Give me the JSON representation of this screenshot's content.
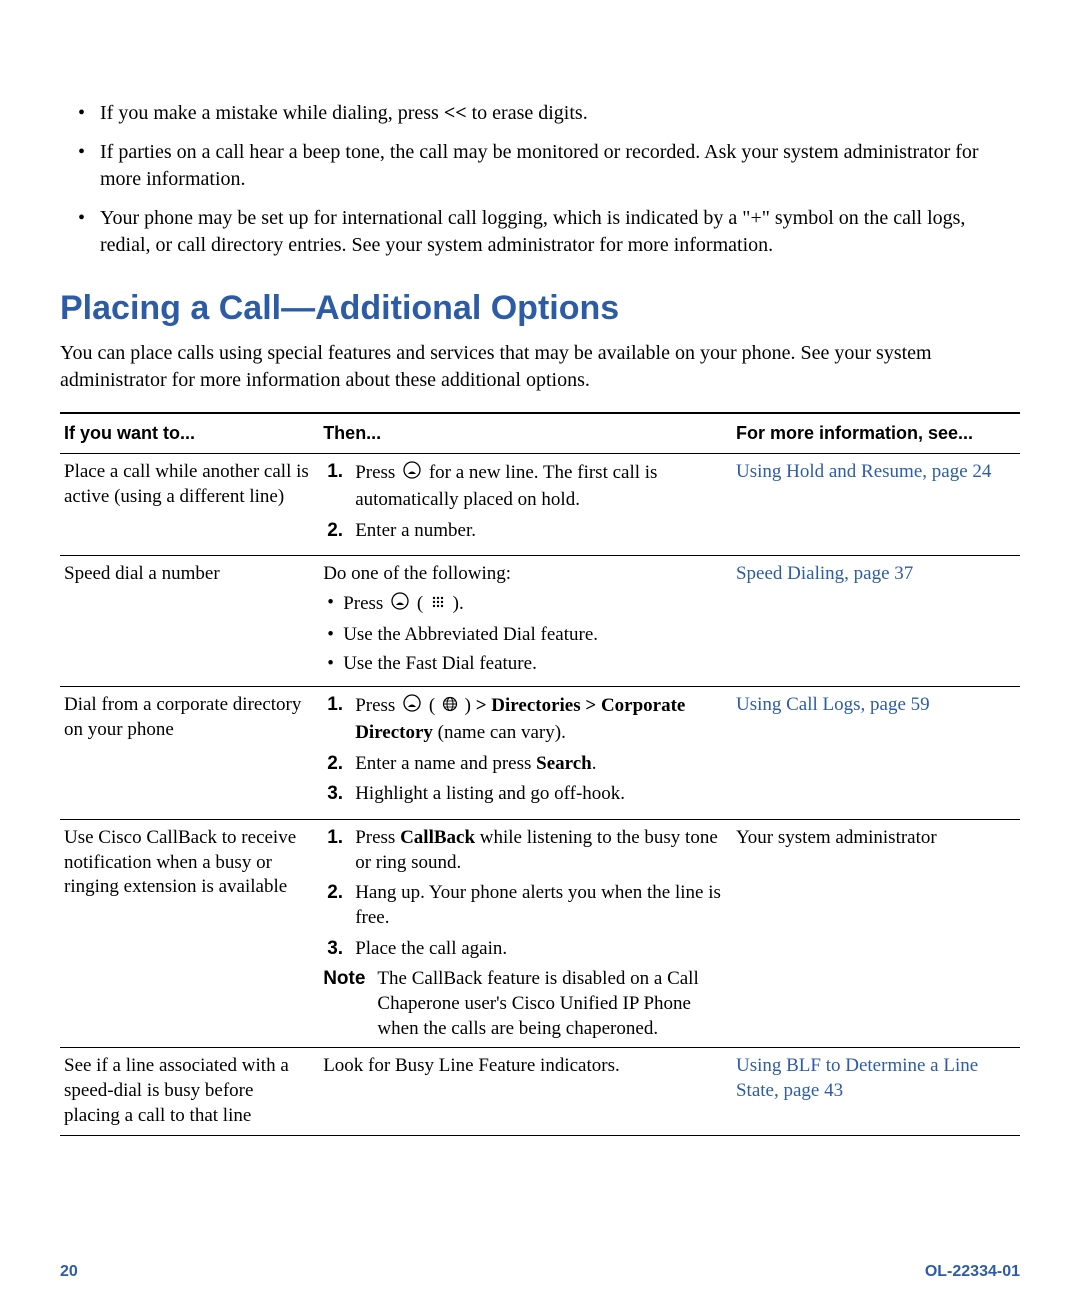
{
  "intro_bullets": {
    "b1_pre": "If you make a mistake while dialing, press ",
    "b1_key": "<<",
    "b1_post": " to erase digits.",
    "b2": "If parties on a call hear a beep tone, the call may be monitored or recorded. Ask your system administrator for more information.",
    "b3": "Your phone may be set up for international call logging, which is indicated by a \"+\" symbol on the call logs, redial, or call directory entries. See your system administrator for more information."
  },
  "heading": "Placing a Call—Additional Options",
  "intro": "You can place calls using special features and services that may be available on your phone. See your system administrator for more information about these additional options.",
  "table": {
    "h1": "If you want to...",
    "h2": "Then...",
    "h3": "For more information, see..."
  },
  "rows": {
    "r1": {
      "c1": "Place a call while another call is active (using a different line)",
      "s1a": "Press ",
      "s1b": " for a new line. The first call is automatically placed on hold.",
      "s2": "Enter a number.",
      "link": "Using Hold and Resume, page 24"
    },
    "r2": {
      "c1": "Speed dial a number",
      "lead": "Do one of the following:",
      "i1a": "Press ",
      "i1b": " ( ",
      "i1c": " ).",
      "i2": "Use the Abbreviated Dial feature.",
      "i3": "Use the Fast Dial feature.",
      "link": "Speed Dialing, page 37"
    },
    "r3": {
      "c1": "Dial from a corporate directory on your phone",
      "s1a": "Press ",
      "s1b": " ( ",
      "s1c": " ) ",
      "s1d": "> Directories > Corporate Directory",
      "s1e": " (name can vary).",
      "s2a": "Enter a name and press ",
      "s2b": "Search",
      "s2c": ".",
      "s3": "Highlight a listing and go off-hook.",
      "link": "Using Call Logs, page 59"
    },
    "r4": {
      "c1": "Use Cisco CallBack to receive notification when a busy or ringing extension is available",
      "s1a": "Press ",
      "s1b": "CallBack",
      "s1c": " while listening to the busy tone or ring sound.",
      "s2": "Hang up. Your phone alerts you when the line is free.",
      "s3": "Place the call again.",
      "note_label": "Note",
      "note_text": "The CallBack feature is disabled on a Call Chaperone user's Cisco Unified IP Phone when the calls are being chaperoned.",
      "c3": "Your system administrator"
    },
    "r5": {
      "c1": "See if a line associated with a speed-dial is busy before placing a call to that line",
      "c2": "Look for Busy Line Feature indicators.",
      "link": "Using BLF to Determine a Line State, page 43"
    }
  },
  "footer": {
    "page": "20",
    "docid": "OL-22334-01"
  }
}
